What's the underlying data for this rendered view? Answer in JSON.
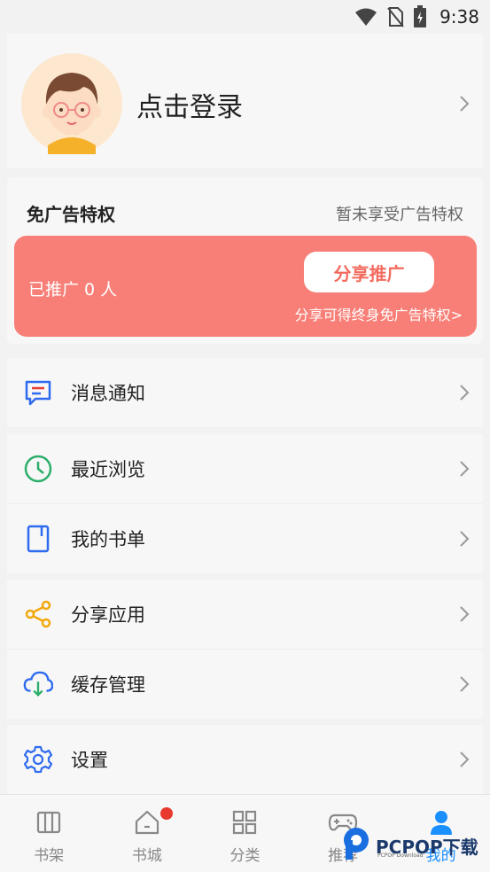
{
  "status_bar": {
    "time": "9:38"
  },
  "profile": {
    "login_label": "点击登录"
  },
  "ad_privilege": {
    "title": "免广告特权",
    "status": "暂未享受广告特权",
    "promoted_count_label": "已推广 0 人",
    "share_button": "分享推广",
    "note": "分享可得终身免广告特权>"
  },
  "menu": {
    "messages": "消息通知",
    "recent": "最近浏览",
    "booklist": "我的书单",
    "share_app": "分享应用",
    "cache": "缓存管理",
    "settings": "设置"
  },
  "tabs": [
    {
      "label": "书架",
      "icon": "bookshelf-icon"
    },
    {
      "label": "书城",
      "icon": "home-icon"
    },
    {
      "label": "分类",
      "icon": "category-icon"
    },
    {
      "label": "推荐",
      "icon": "game-icon"
    },
    {
      "label": "我的",
      "icon": "user-icon"
    }
  ],
  "watermark": {
    "text": "PCPOP下载",
    "sub": "PCPOP Download"
  },
  "colors": {
    "accent": "#1a8fff",
    "promo": "#f77f77",
    "badge": "#e8392f"
  }
}
